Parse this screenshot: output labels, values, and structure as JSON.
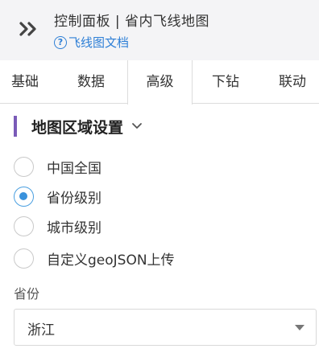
{
  "header": {
    "title": "控制面板 | 省内飞线地图",
    "doc_link": "飞线图文档",
    "expand_icon": "double-chevron-right-icon",
    "help_icon": "question-circle-icon"
  },
  "tabs": [
    {
      "label": "基础"
    },
    {
      "label": "数据"
    },
    {
      "label": "高级",
      "active": true
    },
    {
      "label": "下钻"
    },
    {
      "label": "联动"
    }
  ],
  "section": {
    "title": "地图区域设置",
    "accent_color": "#7a5bb8"
  },
  "map_scope": {
    "options": [
      {
        "label": "中国全国",
        "checked": false
      },
      {
        "label": "省份级别",
        "checked": true
      },
      {
        "label": "城市级别",
        "checked": false
      },
      {
        "label": "自定义geoJSON上传",
        "checked": false
      }
    ]
  },
  "province": {
    "label": "省份",
    "value": "浙江"
  },
  "colors": {
    "link": "#2e7fd6",
    "radio_checked": "#3a92dc",
    "header_bg": "#f4f4f6"
  }
}
